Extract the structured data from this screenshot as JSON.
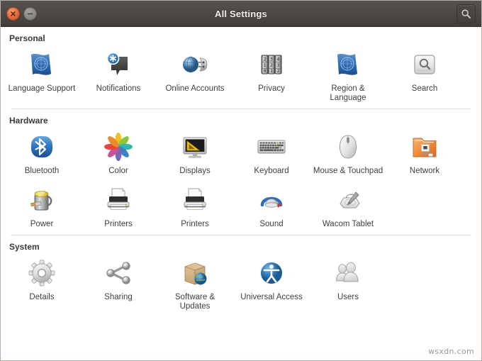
{
  "window": {
    "title": "All Settings",
    "close_label": "Close",
    "minimize_label": "Minimize",
    "search_label": "Search",
    "search_icon": "search-icon",
    "close_icon": "close-icon",
    "minimize_icon": "minimize-icon"
  },
  "watermark": "wsxdn.com",
  "colors": {
    "titlebar_top": "#56524e",
    "titlebar_bottom": "#413d3a",
    "close_button": "#e7683a",
    "minimize_button": "#8d8782",
    "title_text": "#f2efed",
    "background": "#ffffff",
    "section_title": "#3a3a3a",
    "label_text": "#3f3f3f",
    "separator": "#e2e0de",
    "accent_blue": "#3465a4",
    "accent_orange": "#e8762a"
  },
  "sections": [
    {
      "title": "Personal",
      "items": [
        {
          "label": "Language Support",
          "icon": "flag-icon"
        },
        {
          "label": "Notifications",
          "icon": "notification-bubble-icon"
        },
        {
          "label": "Online Accounts",
          "icon": "globe-accounts-icon"
        },
        {
          "label": "Privacy",
          "icon": "combination-lock-icon"
        },
        {
          "label": "Region & Language",
          "icon": "flag-icon"
        },
        {
          "label": "Search",
          "icon": "search-panel-icon"
        }
      ]
    },
    {
      "title": "Hardware",
      "items": [
        {
          "label": "Bluetooth",
          "icon": "bluetooth-icon"
        },
        {
          "label": "Color",
          "icon": "color-flower-icon"
        },
        {
          "label": "Displays",
          "icon": "monitor-icon"
        },
        {
          "label": "Keyboard",
          "icon": "keyboard-icon"
        },
        {
          "label": "Mouse & Touchpad",
          "icon": "mouse-icon"
        },
        {
          "label": "Network",
          "icon": "network-folder-icon"
        },
        {
          "label": "Power",
          "icon": "battery-plug-icon"
        },
        {
          "label": "Printers",
          "icon": "printer-icon"
        },
        {
          "label": "Printers",
          "icon": "printer-icon"
        },
        {
          "label": "Sound",
          "icon": "sound-icon"
        },
        {
          "label": "Wacom Tablet",
          "icon": "wacom-tablet-icon"
        }
      ]
    },
    {
      "title": "System",
      "items": [
        {
          "label": "Details",
          "icon": "gear-icon"
        },
        {
          "label": "Sharing",
          "icon": "share-nodes-icon"
        },
        {
          "label": "Software & Updates",
          "icon": "software-box-icon"
        },
        {
          "label": "Universal Access",
          "icon": "accessibility-icon"
        },
        {
          "label": "Users",
          "icon": "users-icon"
        }
      ]
    }
  ],
  "privacy_lock_digits": [
    [
      "2",
      "1",
      "0"
    ],
    [
      "3",
      "2",
      "1"
    ],
    [
      "4",
      "3",
      "2"
    ]
  ]
}
